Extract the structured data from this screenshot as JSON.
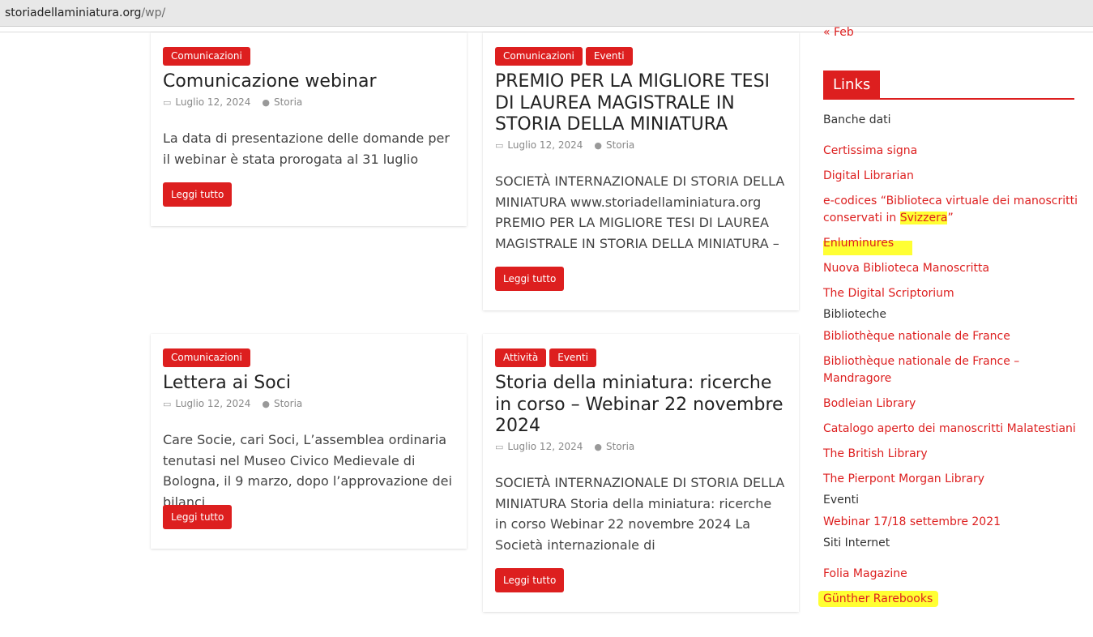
{
  "browser": {
    "url_host": "storiadellaminiatura.org",
    "url_path": "/wp/"
  },
  "posts": [
    {
      "categories": [
        "Comunicazioni"
      ],
      "title": "Comunicazione webinar",
      "date": "Luglio 12, 2024",
      "author": "Storia",
      "excerpt": "La data di presentazione delle domande per il webinar è stata prorogata al 31 luglio",
      "button": "Leggi tutto"
    },
    {
      "categories": [
        "Comunicazioni",
        "Eventi"
      ],
      "title": "PREMIO PER LA MIGLIORE TESI DI LAUREA MAGISTRALE IN STORIA DELLA MINIATURA",
      "date": "Luglio 12, 2024",
      "author": "Storia",
      "excerpt": "SOCIETÀ INTERNAZIONALE DI STORIA DELLA MINIATURA www.storiadellaminiatura.org PREMIO PER LA MIGLIORE TESI DI LAUREA MAGISTRALE IN STORIA DELLA MINIATURA –",
      "button": "Leggi tutto"
    },
    {
      "categories": [
        "Comunicazioni"
      ],
      "title": "Lettera ai Soci",
      "date": "Luglio 12, 2024",
      "author": "Storia",
      "excerpt": "Care Socie, cari Soci, L’assemblea ordinaria tenutasi nel Museo Civico Medievale di Bologna, il 9 marzo, dopo l’approvazione dei bilanci",
      "button": "Leggi tutto"
    },
    {
      "categories": [
        "Attività",
        "Eventi"
      ],
      "title": "Storia della miniatura: ricerche in corso – Webinar 22 novembre 2024",
      "date": "Luglio 12, 2024",
      "author": "Storia",
      "excerpt": "SOCIETÀ INTERNAZIONALE DI STORIA DELLA MINIATURA Storia della miniatura: ricerche in corso Webinar 22 novembre 2024 La Società internazionale di",
      "button": "Leggi tutto"
    }
  ],
  "sidebar": {
    "prev_month": "« Feb",
    "links_title": "Links",
    "items": [
      {
        "type": "category",
        "text": "Banche dati"
      },
      {
        "type": "link",
        "text": "Certissima signa"
      },
      {
        "type": "link",
        "text": "Digital Librarian"
      },
      {
        "type": "link",
        "text_line1": "e-codices “Biblioteca virtuale dei manoscritti",
        "text_line2_pre": "conservati in ",
        "text_line2_hl": "Svizzera",
        "text_line2_post": "”"
      },
      {
        "type": "link",
        "text": "Enluminures"
      },
      {
        "type": "link",
        "text": "Nuova Biblioteca Manoscritta"
      },
      {
        "type": "link",
        "text": "The Digital Scriptorium"
      },
      {
        "type": "category",
        "text": "Biblioteche"
      },
      {
        "type": "link",
        "text": "Bibliothèque nationale de France"
      },
      {
        "type": "link",
        "text_line1": "Bibliothèque nationale de France –",
        "text_line2": "Mandragore"
      },
      {
        "type": "link",
        "text": "Bodleian Library"
      },
      {
        "type": "link",
        "text": "Catalogo aperto dei manoscritti Malatestiani"
      },
      {
        "type": "link",
        "text": "The British Library"
      },
      {
        "type": "link",
        "text": "The Pierpont Morgan Library"
      },
      {
        "type": "category",
        "text": "Eventi"
      },
      {
        "type": "link",
        "text": "Webinar 17/18 settembre 2021"
      },
      {
        "type": "category",
        "text": "Siti Internet"
      },
      {
        "type": "link",
        "text": "Folia Magazine"
      },
      {
        "type": "link",
        "text": "Günther Rarebooks"
      }
    ]
  },
  "colors": {
    "accent": "#dd1f1f",
    "highlight": "#ffff33"
  }
}
